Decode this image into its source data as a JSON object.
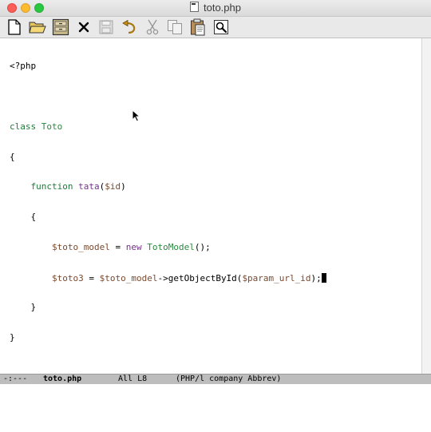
{
  "window": {
    "title": "toto.php",
    "controls": [
      "close",
      "minimize",
      "zoom"
    ]
  },
  "toolbar": {
    "buttons": [
      {
        "name": "new-file-button",
        "icon": "new-document-icon",
        "enabled": true
      },
      {
        "name": "open-file-button",
        "icon": "open-folder-icon",
        "enabled": true
      },
      {
        "name": "dired-button",
        "icon": "file-cabinet-icon",
        "enabled": true
      },
      {
        "name": "close-buffer-button",
        "icon": "x-icon",
        "enabled": true
      },
      {
        "name": "save-button",
        "icon": "floppy-disk-icon",
        "enabled": false
      },
      {
        "name": "undo-button",
        "icon": "undo-arrow-icon",
        "enabled": true
      },
      {
        "name": "cut-button",
        "icon": "scissors-icon",
        "enabled": false
      },
      {
        "name": "copy-button",
        "icon": "copy-pages-icon",
        "enabled": false
      },
      {
        "name": "paste-button",
        "icon": "clipboard-icon",
        "enabled": true
      },
      {
        "name": "search-button",
        "icon": "magnifier-icon",
        "enabled": true
      }
    ]
  },
  "code": {
    "lines": [
      "<?php",
      "",
      "class Toto",
      "{",
      "    function tata($id)",
      "    {",
      "        $toto_model = new TotoModel();",
      "        $toto3 = $toto_model->getObjectById($param_url_id);",
      "    }",
      "}",
      "",
      "?>"
    ]
  },
  "modeline": {
    "state": "-:---",
    "buffer": "toto.php",
    "position": "All L8",
    "modes": "(PHP/l company Abbrev)"
  },
  "colors": {
    "keyword": "#1f7a3a",
    "function_name": "#7a2f8f",
    "class_name": "#2b8a3e",
    "variable": "#7a4a2f",
    "modeline_bg": "#bdbdbd"
  }
}
